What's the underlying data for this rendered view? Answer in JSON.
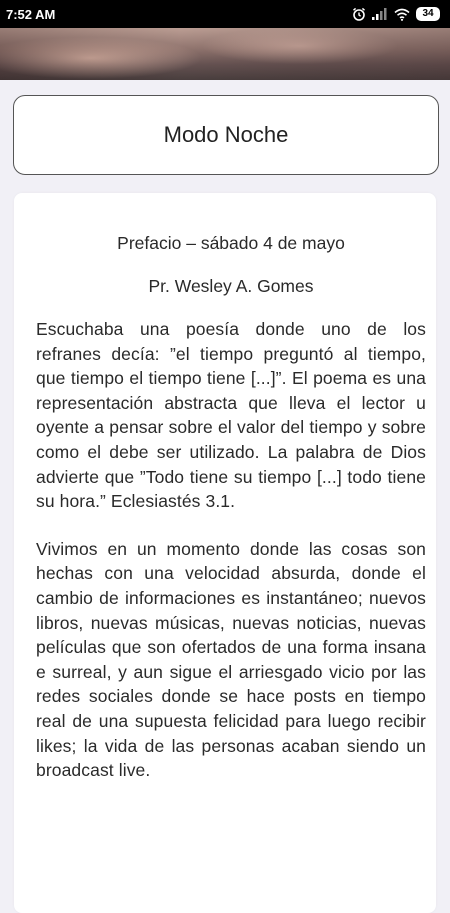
{
  "status_bar": {
    "time": "7:52 AM",
    "battery": "34"
  },
  "night_mode_button": {
    "label": "Modo Noche"
  },
  "article": {
    "title": "Prefacio – sábado 4 de mayo",
    "author": "Pr. Wesley A. Gomes",
    "paragraphs": [
      "Escuchaba una poesía donde uno de los refranes decía: ”el tiempo preguntó al tiempo, que tiempo el tiempo tiene [...]”. El poema es una representación abstracta que lleva el lector u oyente a pensar sobre el valor del tiempo y sobre como el debe ser utilizado. La palabra de Dios advierte que ”Todo tiene su tiempo [...] todo tiene su hora.” Eclesiastés 3.1.",
      "Vivimos en un momento donde las cosas son hechas con una velocidad absurda, donde el cambio de informaciones es instantáneo; nuevos libros, nuevas músicas, nuevas noticias, nuevas películas que son ofertados de una forma insana e surreal, y aun sigue el arriesgado vicio por las redes sociales donde se hace posts en tiempo real de una supuesta felicidad para luego recibir likes; la vida de las personas acaban siendo un broadcast live."
    ]
  },
  "icons": {
    "alarm": "alarm-icon",
    "signal": "signal-icon",
    "wifi": "wifi-icon",
    "battery": "battery-icon"
  }
}
